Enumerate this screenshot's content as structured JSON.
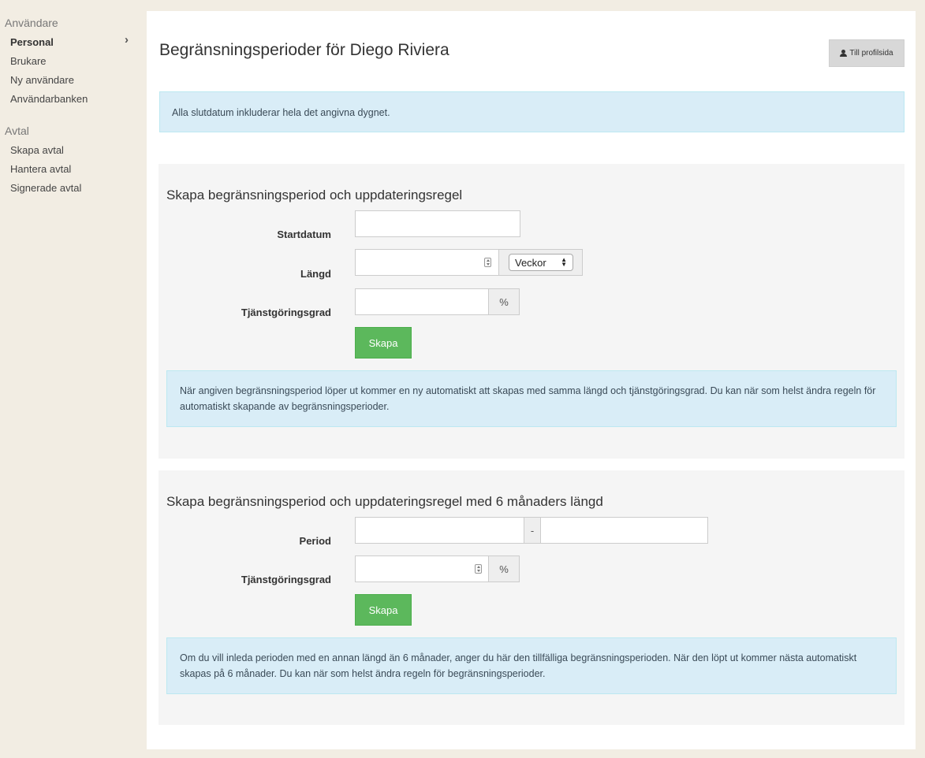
{
  "sidebar": {
    "groups": [
      {
        "title": "Användare",
        "items": [
          {
            "label": "Personal",
            "active": true
          },
          {
            "label": "Brukare"
          },
          {
            "label": "Ny användare"
          },
          {
            "label": "Användarbanken"
          }
        ]
      },
      {
        "title": "Avtal",
        "items": [
          {
            "label": "Skapa avtal"
          },
          {
            "label": "Hantera avtal"
          },
          {
            "label": "Signerade avtal"
          }
        ]
      }
    ],
    "chevron": "›"
  },
  "header": {
    "title": "Begränsningsperioder för Diego Riviera",
    "profile_button": "Till profilsida"
  },
  "info_top": "Alla slutdatum inkluderar hela det angivna dygnet.",
  "section1": {
    "title": "Skapa begränsningsperiod och uppdateringsregel",
    "start_label": "Startdatum",
    "start_value": "",
    "length_label": "Längd",
    "length_value": "",
    "unit_selected": "Veckor",
    "degree_label": "Tjänstgöringsgrad",
    "degree_value": "",
    "percent": "%",
    "submit": "Skapa",
    "info": "När angiven begränsningsperiod löper ut kommer en ny automatiskt att skapas med samma längd och tjänstgöringsgrad. Du kan när som helst ändra regeln för automatiskt skapande av begränsningsperioder."
  },
  "section2": {
    "title": "Skapa begränsningsperiod och uppdateringsregel med 6 månaders längd",
    "period_label": "Period",
    "period_from": "",
    "period_sep": "-",
    "period_to": "",
    "degree_label": "Tjänstgöringsgrad",
    "degree_value": "",
    "percent": "%",
    "submit": "Skapa",
    "info": "Om du vill inleda perioden med en annan längd än 6 månader, anger du här den tillfälliga begränsningsperioden. När den löpt ut kommer nästa automatiskt skapas på 6 månader. Du kan när som helst ändra regeln för begränsningsperioder."
  },
  "colors": {
    "background": "#f2ede3",
    "info_bg": "#d9edf7",
    "success": "#5cb85c"
  }
}
